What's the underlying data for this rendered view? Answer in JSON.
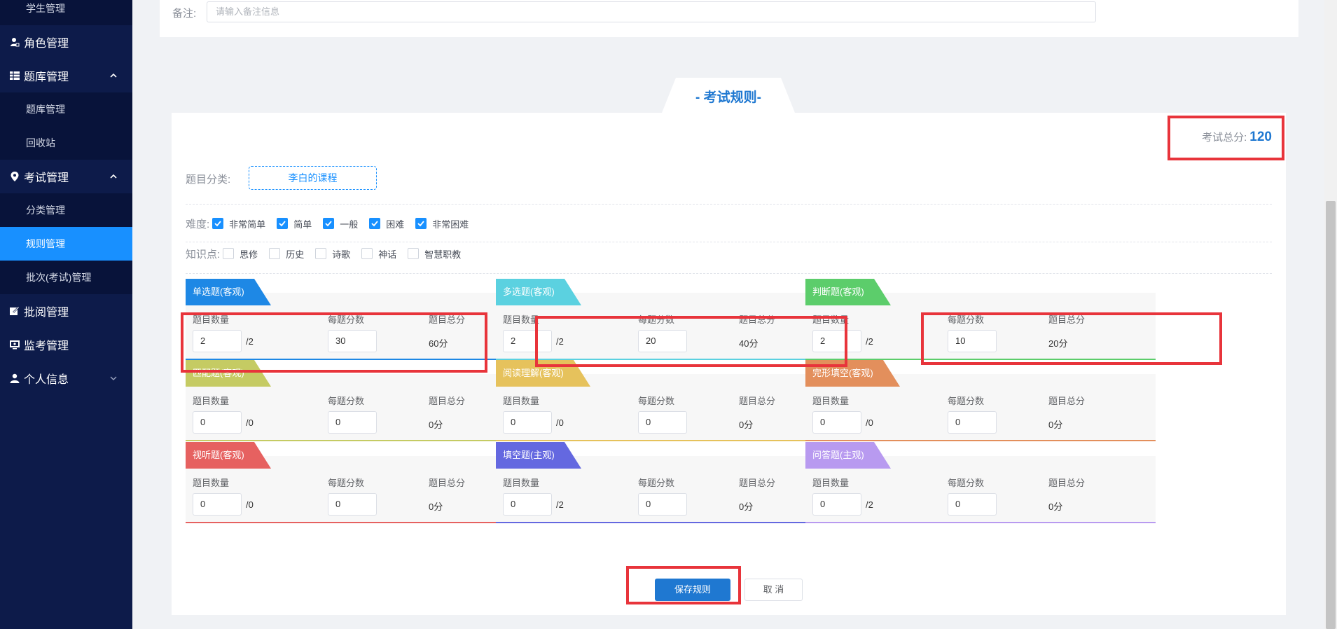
{
  "sidebar": {
    "items": [
      {
        "label": "学生管理",
        "kind": "sub",
        "active": false
      },
      {
        "label": "角色管理",
        "kind": "menu",
        "icon": "user-role-icon"
      },
      {
        "label": "题库管理",
        "kind": "menu",
        "icon": "table-icon",
        "expanded": true
      },
      {
        "label": "题库管理",
        "kind": "sub",
        "active": false
      },
      {
        "label": "回收站",
        "kind": "sub",
        "active": false
      },
      {
        "label": "考试管理",
        "kind": "menu",
        "icon": "map-pin-icon",
        "expanded": true
      },
      {
        "label": "分类管理",
        "kind": "sub",
        "active": false
      },
      {
        "label": "规则管理",
        "kind": "sub",
        "active": true
      },
      {
        "label": "批次(考试)管理",
        "kind": "sub",
        "active": false
      },
      {
        "label": "批阅管理",
        "kind": "menu",
        "icon": "edit-icon"
      },
      {
        "label": "监考管理",
        "kind": "menu",
        "icon": "monitor-icon"
      },
      {
        "label": "个人信息",
        "kind": "menu",
        "icon": "user-icon",
        "expanded": false
      }
    ]
  },
  "remark": {
    "label": "备注:",
    "placeholder": "请输入备注信息"
  },
  "rules": {
    "title": "- 考试规则-",
    "total_label": "考试总分:",
    "total_value": "120",
    "category_label": "题目分类:",
    "category_value": "李白的课程",
    "difficulty_label": "难度:",
    "difficulty": [
      {
        "label": "非常简单",
        "checked": true
      },
      {
        "label": "简单",
        "checked": true
      },
      {
        "label": "一般",
        "checked": true
      },
      {
        "label": "困难",
        "checked": true
      },
      {
        "label": "非常困难",
        "checked": true
      }
    ],
    "knowledge_label": "知识点:",
    "knowledge": [
      {
        "label": "思修",
        "checked": false
      },
      {
        "label": "历史",
        "checked": false
      },
      {
        "label": "诗歌",
        "checked": false
      },
      {
        "label": "神话",
        "checked": false
      },
      {
        "label": "智慧职教",
        "checked": false
      }
    ],
    "headers": {
      "count": "题目数量",
      "per": "每题分数",
      "total": "题目总分"
    },
    "cards": [
      {
        "title": "单选题(客观)",
        "color": "#1e88e5",
        "count": "2",
        "max": "/2",
        "per": "30",
        "sum": "60分"
      },
      {
        "title": "多选题(客观)",
        "color": "#5bd1e0",
        "count": "2",
        "max": "/2",
        "per": "20",
        "sum": "40分"
      },
      {
        "title": "判断题(客观)",
        "color": "#5ccd6b",
        "count": "2",
        "max": "/2",
        "per": "10",
        "sum": "20分"
      },
      {
        "title": "匹配题(客观)",
        "color": "#c5cb63",
        "count": "0",
        "max": "/0",
        "per": "0",
        "sum": "0分"
      },
      {
        "title": "阅读理解(客观)",
        "color": "#e6c25c",
        "count": "0",
        "max": "/0",
        "per": "0",
        "sum": "0分"
      },
      {
        "title": "完形填空(客观)",
        "color": "#e38f5c",
        "count": "0",
        "max": "/0",
        "per": "0",
        "sum": "0分"
      },
      {
        "title": "视听题(客观)",
        "color": "#e66160",
        "count": "0",
        "max": "/0",
        "per": "0",
        "sum": "0分"
      },
      {
        "title": "填空题(主观)",
        "color": "#6468e0",
        "count": "0",
        "max": "/2",
        "per": "0",
        "sum": "0分"
      },
      {
        "title": "问答题(主观)",
        "color": "#b89af0",
        "count": "0",
        "max": "/2",
        "per": "0",
        "sum": "0分"
      }
    ],
    "save_label": "保存规则",
    "cancel_label": "取 消"
  },
  "colors": {
    "sidebar_bg": "#0d1b4a",
    "active": "#1890ff",
    "accent": "#1f78d1",
    "highlight": "#e8343b"
  }
}
